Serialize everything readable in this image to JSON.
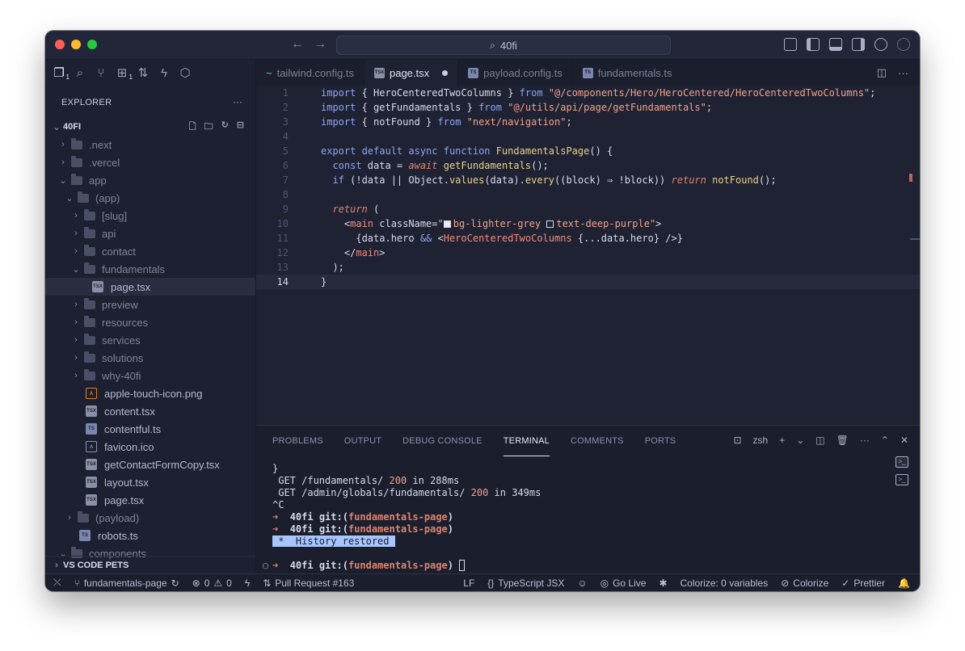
{
  "window": {
    "title": "40fi"
  },
  "sidebar": {
    "explorer_title": "EXPLORER",
    "more": "···",
    "root": "40FI",
    "tree": [
      {
        "label": ".next",
        "type": "folder",
        "depth": 1,
        "open": false
      },
      {
        "label": ".vercel",
        "type": "folder",
        "depth": 1,
        "open": false
      },
      {
        "label": "app",
        "type": "folder",
        "depth": 1,
        "open": true
      },
      {
        "label": "(app)",
        "type": "folder",
        "depth": 2,
        "open": true
      },
      {
        "label": "[slug]",
        "type": "folder",
        "depth": 3,
        "open": false
      },
      {
        "label": "api",
        "type": "folder",
        "depth": 3,
        "open": false
      },
      {
        "label": "contact",
        "type": "folder",
        "depth": 3,
        "open": false
      },
      {
        "label": "fundamentals",
        "type": "folder",
        "depth": 3,
        "open": true
      },
      {
        "label": "page.tsx",
        "type": "tsx",
        "depth": 4,
        "selected": true
      },
      {
        "label": "preview",
        "type": "folder",
        "depth": 3,
        "open": false
      },
      {
        "label": "resources",
        "type": "folder",
        "depth": 3,
        "open": false
      },
      {
        "label": "services",
        "type": "folder",
        "depth": 3,
        "open": false
      },
      {
        "label": "solutions",
        "type": "folder",
        "depth": 3,
        "open": false
      },
      {
        "label": "why-40fi",
        "type": "folder",
        "depth": 3,
        "open": false
      },
      {
        "label": "apple-touch-icon.png",
        "type": "png",
        "depth": 3
      },
      {
        "label": "content.tsx",
        "type": "tsx",
        "depth": 3
      },
      {
        "label": "contentful.ts",
        "type": "ts",
        "depth": 3
      },
      {
        "label": "favicon.ico",
        "type": "ico",
        "depth": 3
      },
      {
        "label": "getContactFormCopy.tsx",
        "type": "tsx",
        "depth": 3
      },
      {
        "label": "layout.tsx",
        "type": "tsx",
        "depth": 3
      },
      {
        "label": "page.tsx",
        "type": "tsx",
        "depth": 3
      },
      {
        "label": "(payload)",
        "type": "folder",
        "depth": 2,
        "open": false
      },
      {
        "label": "robots.ts",
        "type": "ts",
        "depth": 2
      },
      {
        "label": "components",
        "type": "folder",
        "depth": 1,
        "open": true
      }
    ],
    "bottom_section": "VS CODE PETS"
  },
  "tabs": [
    {
      "label": "tailwind.config.ts",
      "icon": "tailwind"
    },
    {
      "label": "page.tsx",
      "icon": "TSX",
      "active": true,
      "dirty": true
    },
    {
      "label": "payload.config.ts",
      "icon": "TS"
    },
    {
      "label": "fundamentals.ts",
      "icon": "TS"
    }
  ],
  "code": {
    "current_line": 14,
    "line_numbers": [
      "1",
      "2",
      "3",
      "4",
      "5",
      "6",
      "7",
      "8",
      "9",
      "10",
      "11",
      "12",
      "13",
      "14"
    ]
  },
  "panel": {
    "tabs": [
      "PROBLEMS",
      "OUTPUT",
      "DEBUG CONSOLE",
      "TERMINAL",
      "COMMENTS",
      "PORTS"
    ],
    "active_tab": "TERMINAL",
    "shell": "zsh",
    "terminal": {
      "brace": "}",
      "get1_path": " GET /fundamentals/ ",
      "get1_status": "200",
      "get1_time": " in 288ms",
      "get2_path": " GET /admin/globals/fundamentals/ ",
      "get2_status": "200",
      "get2_time": " in 349ms",
      "ctrl_c": "^C",
      "prompt_dir": "40fi",
      "prompt_git": "git:(",
      "branch": "fundamentals-page",
      "prompt_close": ")",
      "history": " *  History restored "
    }
  },
  "statusbar": {
    "branch": "fundamentals-page",
    "errors": "0",
    "warnings": "0",
    "pull_request": "Pull Request #163",
    "eol": "LF",
    "language": "TypeScript JSX",
    "go_live": "Go Live",
    "colorize_vars": "Colorize: 0 variables",
    "colorize": "Colorize",
    "prettier": "Prettier"
  }
}
